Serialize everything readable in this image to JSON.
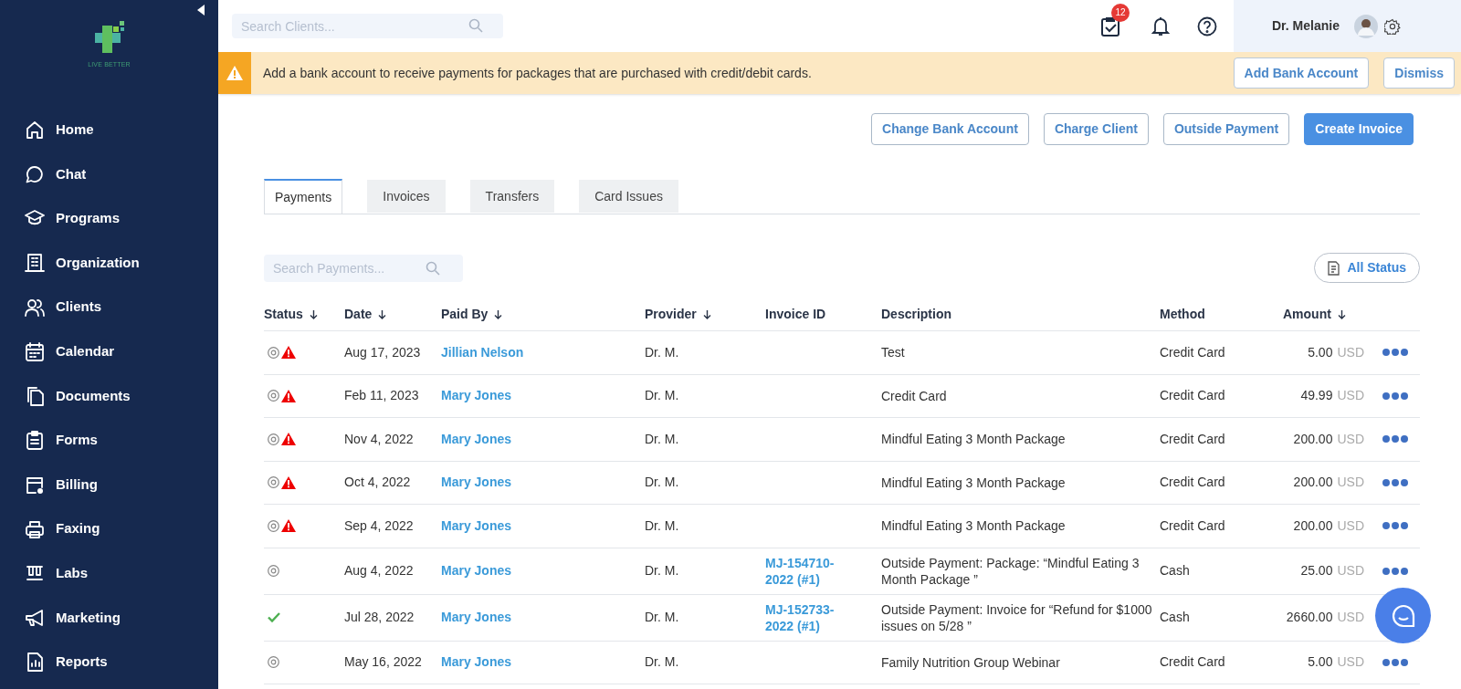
{
  "sidebar": {
    "logo_text": "LIVE BETTER",
    "items": [
      {
        "label": "Home",
        "kind": "home"
      },
      {
        "label": "Chat",
        "kind": "chat"
      },
      {
        "label": "Programs",
        "kind": "programs"
      },
      {
        "label": "Organization",
        "kind": "organization"
      },
      {
        "label": "Clients",
        "kind": "clients"
      },
      {
        "label": "Calendar",
        "kind": "calendar"
      },
      {
        "label": "Documents",
        "kind": "documents"
      },
      {
        "label": "Forms",
        "kind": "forms"
      },
      {
        "label": "Billing",
        "kind": "billing"
      },
      {
        "label": "Faxing",
        "kind": "faxing"
      },
      {
        "label": "Labs",
        "kind": "labs"
      },
      {
        "label": "Marketing",
        "kind": "marketing"
      },
      {
        "label": "Reports",
        "kind": "reports"
      }
    ]
  },
  "header": {
    "search": {
      "placeholder": "Search Clients..."
    },
    "tasks_badge": "12",
    "user_name": "Dr. Melanie"
  },
  "banner": {
    "message": "Add a bank account to receive payments for packages that are purchased with credit/debit cards.",
    "buttons": [
      "Add Bank Account",
      "Dismiss"
    ]
  },
  "page": {
    "actions": [
      {
        "label": "Change Bank Account",
        "primary": false
      },
      {
        "label": "Charge Client",
        "primary": false
      },
      {
        "label": "Outside Payment",
        "primary": false
      },
      {
        "label": "Create Invoice",
        "primary": true
      }
    ]
  },
  "tabs": [
    {
      "label": "Payments",
      "selected": true
    },
    {
      "label": "Invoices",
      "selected": false
    },
    {
      "label": "Transfers",
      "selected": false
    },
    {
      "label": "Card Issues",
      "selected": false
    }
  ],
  "search": {
    "placeholder": "Search Payments..."
  },
  "filter": {
    "label": "All Status"
  },
  "table": {
    "columns": [
      {
        "label": "Status",
        "sortable": true
      },
      {
        "label": "Date",
        "sortable": true
      },
      {
        "label": "Paid By",
        "sortable": true
      },
      {
        "label": "Provider",
        "sortable": true
      },
      {
        "label": "Invoice ID",
        "sortable": false
      },
      {
        "label": "Description",
        "sortable": false
      },
      {
        "label": "Method",
        "sortable": false
      },
      {
        "label": "Amount",
        "sortable": true
      }
    ],
    "rows": [
      {
        "paid": false,
        "warning": true,
        "date": "Aug 17, 2023",
        "paid_by": "Jillian Nelson",
        "provider": "Dr. M.",
        "description": "Test",
        "method": "Credit Card",
        "amount": "5.00",
        "currency": "USD"
      },
      {
        "paid": false,
        "warning": true,
        "date": "Feb 11, 2023",
        "paid_by": "Mary Jones",
        "provider": "Dr. M.",
        "description": "Credit Card",
        "method": "Credit Card",
        "amount": "49.99",
        "currency": "USD"
      },
      {
        "paid": false,
        "warning": true,
        "date": "Nov 4, 2022",
        "paid_by": "Mary Jones",
        "provider": "Dr. M.",
        "description": "Mindful Eating 3 Month Package",
        "method": "Credit Card",
        "amount": "200.00",
        "currency": "USD"
      },
      {
        "paid": false,
        "warning": true,
        "date": "Oct 4, 2022",
        "paid_by": "Mary Jones",
        "provider": "Dr. M.",
        "description": "Mindful Eating 3 Month Package",
        "method": "Credit Card",
        "amount": "200.00",
        "currency": "USD"
      },
      {
        "paid": false,
        "warning": true,
        "date": "Sep 4, 2022",
        "paid_by": "Mary Jones",
        "provider": "Dr. M.",
        "description": "Mindful Eating 3 Month Package",
        "method": "Credit Card",
        "amount": "200.00",
        "currency": "USD"
      },
      {
        "paid": false,
        "warning": false,
        "date": "Aug 4, 2022",
        "paid_by": "Mary Jones",
        "provider": "Dr. M.",
        "invoice_id": "MJ-154710-2022 (#1)",
        "description": "Outside Payment: Package: “Mindful Eating 3 Month Package ”",
        "method": "Cash",
        "amount": "25.00",
        "currency": "USD"
      },
      {
        "paid": true,
        "warning": false,
        "date": "Jul 28, 2022",
        "paid_by": "Mary Jones",
        "provider": "Dr. M.",
        "invoice_id": "MJ-152733-2022 (#1)",
        "description": "Outside Payment: Invoice for “Refund for $1000 issues on 5/28 ”",
        "method": "Cash",
        "amount": "2660.00",
        "currency": "USD"
      },
      {
        "paid": false,
        "warning": false,
        "date": "May 16, 2022",
        "paid_by": "Mary Jones",
        "provider": "Dr. M.",
        "description": "Family Nutrition Group Webinar",
        "method": "Credit Card",
        "amount": "5.00",
        "currency": "USD"
      }
    ]
  }
}
